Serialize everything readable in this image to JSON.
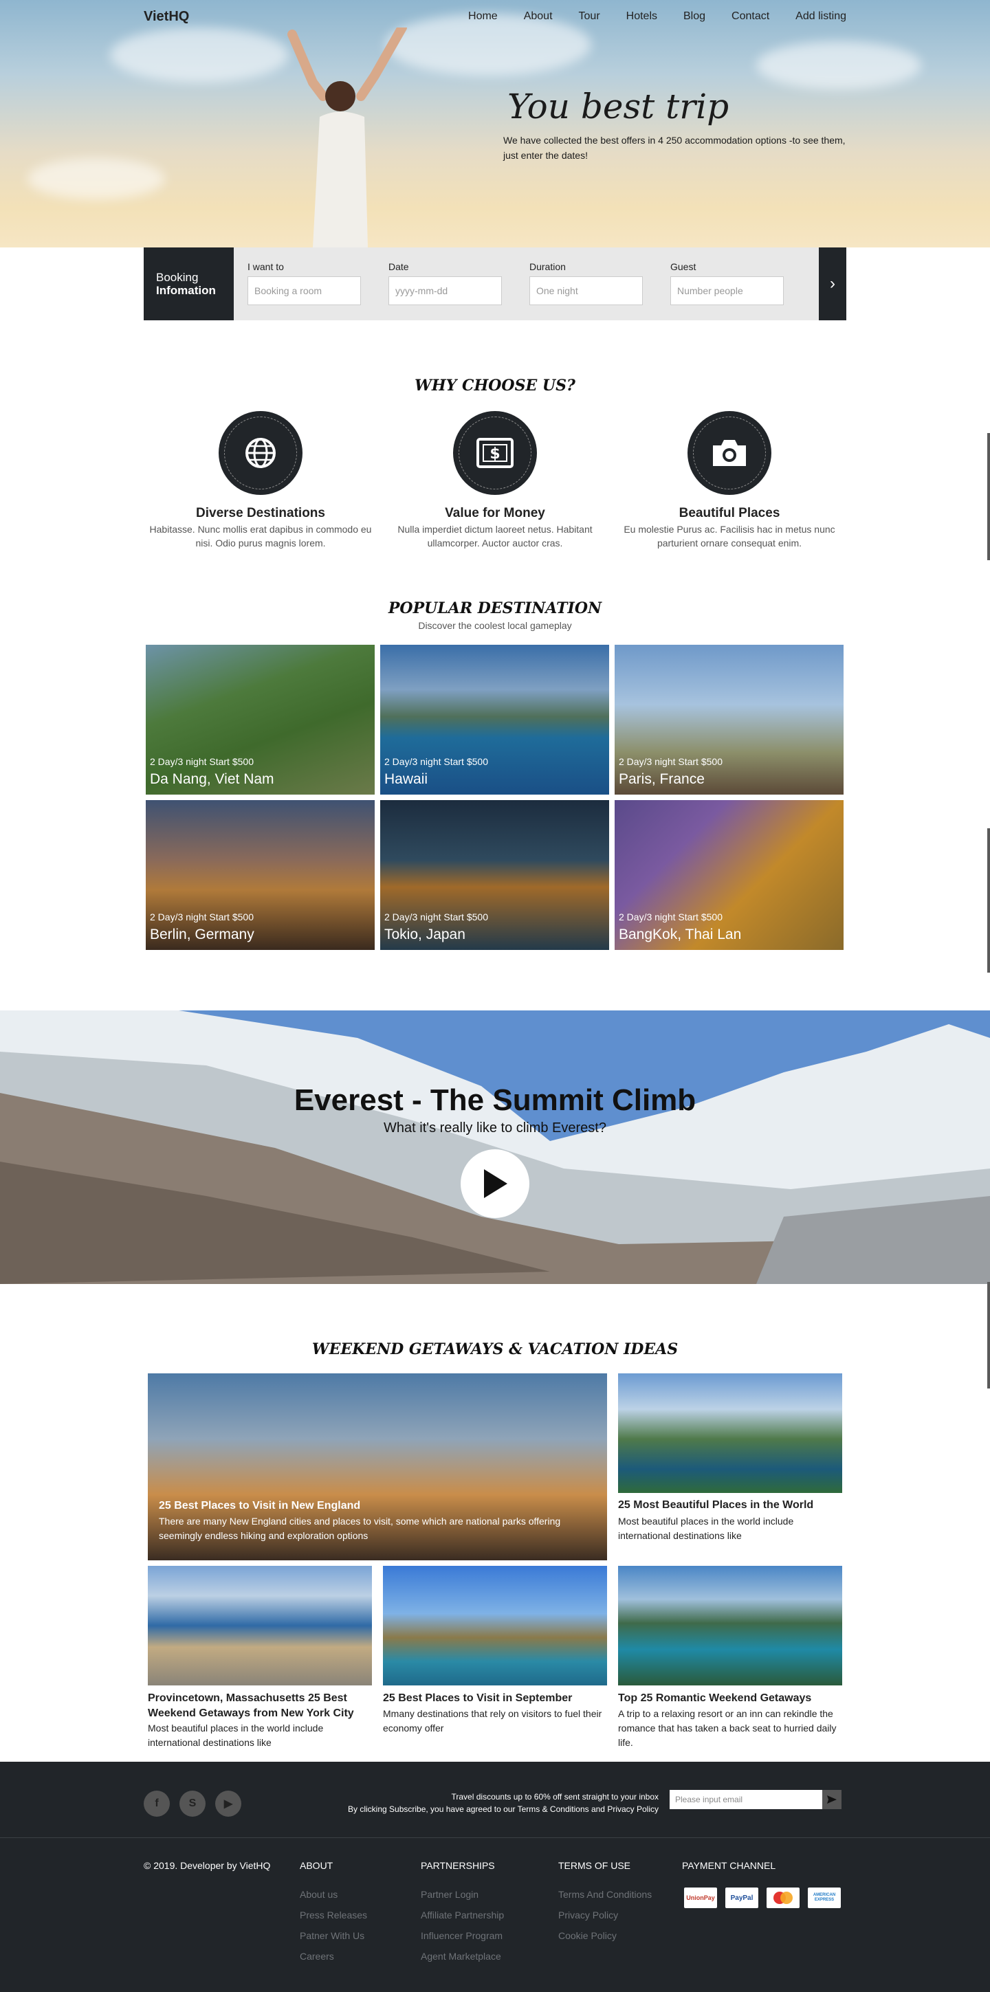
{
  "nav": {
    "logo": "VietHQ",
    "items": [
      "Home",
      "About",
      "Tour",
      "Hotels",
      "Blog",
      "Contact",
      "Add listing"
    ]
  },
  "hero": {
    "title": "You best trip",
    "subtitle": "We have collected the best offers in 4 250 accommodation options -to see them, just enter the dates!"
  },
  "booking": {
    "label_line1": "Booking",
    "label_line2": "Infomation",
    "fields": [
      {
        "label": "I want to",
        "placeholder": "Booking a room"
      },
      {
        "label": "Date",
        "placeholder": "yyyy-mm-dd"
      },
      {
        "label": "Duration",
        "placeholder": "One night"
      },
      {
        "label": "Guest",
        "placeholder": "Number people"
      }
    ],
    "submit_icon": "chevron-right-icon"
  },
  "why": {
    "title": "WHY CHOOSE US?",
    "features": [
      {
        "icon": "globe-icon",
        "title": "Diverse Destinations",
        "text": "Habitasse. Nunc mollis erat dapibus in commodo eu nisi. Odio purus magnis lorem."
      },
      {
        "icon": "money-icon",
        "title": "Value for Money",
        "text": "Nulla imperdiet dictum laoreet netus. Habitant ullamcorper. Auctor auctor cras."
      },
      {
        "icon": "camera-icon",
        "title": "Beautiful Places",
        "text": "Eu molestie Purus ac. Facilisis hac in metus nunc parturient ornare consequat enim."
      }
    ]
  },
  "popular": {
    "title": "POPULAR DESTINATION",
    "subtitle": "Discover the coolest local gameplay",
    "items": [
      {
        "offer": "2 Day/3 night Start $500",
        "name": "Da Nang, Viet Nam"
      },
      {
        "offer": "2 Day/3 night Start $500",
        "name": "Hawaii"
      },
      {
        "offer": "2 Day/3 night Start $500",
        "name": "Paris, France"
      },
      {
        "offer": "2 Day/3 night Start $500",
        "name": "Berlin, Germany"
      },
      {
        "offer": "2 Day/3 night Start $500",
        "name": "Tokio, Japan"
      },
      {
        "offer": "2 Day/3 night Start $500",
        "name": "BangKok, Thai Lan"
      }
    ]
  },
  "video": {
    "title": "Everest - The Summit Climb",
    "subtitle": "What it's really like to climb Everest?"
  },
  "weekend": {
    "title": "WEEKEND GETAWAYS & VACATION IDEAS",
    "cards": [
      {
        "title": "25 Best Places to Visit in New England",
        "text": "There are many New England cities and places to visit, some which are national parks offering seemingly endless hiking and exploration options"
      },
      {
        "title": "25 Most Beautiful Places in the World",
        "text": "Most beautiful places in the world include international destinations like"
      },
      {
        "title": "Provincetown, Massachusetts 25 Best Weekend Getaways from New York City",
        "text": "Most beautiful places in the world include international destinations like"
      },
      {
        "title": "25 Best Places to Visit in September",
        "text": "Mmany destinations that rely on visitors to fuel their economy offer"
      },
      {
        "title": "Top 25 Romantic Weekend Getaways",
        "text": "A trip to a relaxing resort or an inn can rekindle the romance that has taken a back seat to hurried daily life."
      }
    ]
  },
  "footer": {
    "social": [
      "facebook-icon",
      "skype-icon",
      "youtube-icon"
    ],
    "subscribe_line1": "Travel discounts up to 60% off sent straight to your inbox",
    "subscribe_line2": "By clicking Subscribe, you have agreed to our Terms & Conditions and Privacy Policy",
    "email_placeholder": "Please input email",
    "copyright": "© 2019. Developer by VietHQ",
    "about": {
      "title": "ABOUT",
      "links": [
        "About us",
        "Press Releases",
        "Patner With Us",
        "Careers"
      ]
    },
    "partnerships": {
      "title": "PARTNERSHIPS",
      "links": [
        "Partner Login",
        "Affiliate Partnership",
        "Influencer Program",
        "Agent Marketplace"
      ]
    },
    "terms": {
      "title": "TERMS OF USE",
      "links": [
        "Terms And Conditions",
        "Privacy Policy",
        "Cookie Policy"
      ]
    },
    "payment": {
      "title": "PAYMENT CHANNEL",
      "methods": [
        "UnionPay",
        "PayPal",
        "MasterCard",
        "AMERICAN EXPRESS"
      ]
    }
  }
}
